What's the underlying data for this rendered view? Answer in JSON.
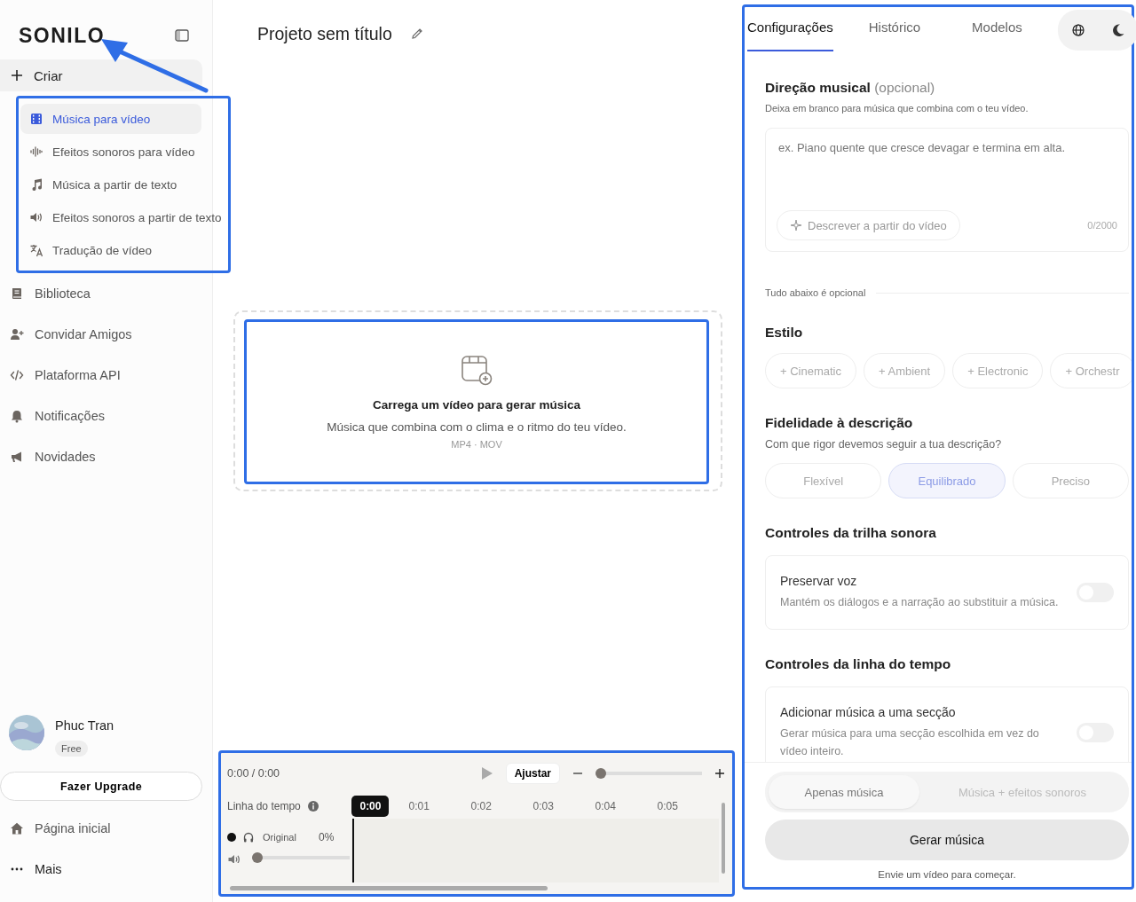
{
  "sidebar": {
    "logo": "SONILO",
    "create": {
      "label": "Criar",
      "items": [
        {
          "label": "Música para vídeo",
          "selected": true
        },
        {
          "label": "Efeitos sonoros para vídeo",
          "selected": false
        },
        {
          "label": "Música a partir de texto",
          "selected": false
        },
        {
          "label": "Efeitos sonoros a partir de texto",
          "selected": false
        },
        {
          "label": "Tradução de vídeo",
          "selected": false
        }
      ]
    },
    "nav": [
      "Biblioteca",
      "Convidar Amigos",
      "Plataforma API",
      "Notificações",
      "Novidades"
    ],
    "user": {
      "name": "Phuc Tran",
      "plan": "Free"
    },
    "upgrade_button": "Fazer Upgrade",
    "footer_nav": [
      "Página inicial",
      "Mais"
    ]
  },
  "project": {
    "title": "Projeto sem título"
  },
  "upload": {
    "title": "Carrega um vídeo para gerar música",
    "subtitle": "Música que combina com o clima e o ritmo do teu vídeo.",
    "formats": "MP4 · MOV"
  },
  "player": {
    "time": "0:00 / 0:00",
    "fit_button": "Ajustar",
    "zoom": {
      "level": 0
    },
    "timeline_label": "Linha do tempo",
    "current": "0:00",
    "ticks": [
      "0:01",
      "0:02",
      "0:03",
      "0:04",
      "0:05"
    ],
    "tracks": [
      {
        "name": "Original",
        "percent": "0%",
        "volume": {
          "level": 0
        }
      }
    ]
  },
  "settings": {
    "tabs": [
      {
        "label": "Configurações",
        "selected": true
      },
      {
        "label": "Histórico",
        "selected": false
      },
      {
        "label": "Modelos",
        "selected": false
      }
    ],
    "direction": {
      "title": "Direção musical",
      "optional": "(opcional)",
      "hint": "Deixa em branco para música que combina com o teu vídeo.",
      "placeholder": "ex. Piano quente que cresce devagar e termina em alta.",
      "describe_button": "Descrever a partir do vídeo",
      "counter": "0/2000"
    },
    "divider_label": "Tudo abaixo é opcional",
    "style": {
      "title": "Estilo",
      "chips": [
        "+ Cinematic",
        "+ Ambient",
        "+ Electronic",
        "+ Orchestr"
      ]
    },
    "fidelity": {
      "title": "Fidelidade à descrição",
      "hint": "Com que rigor devemos seguir a tua descrição?",
      "options": [
        {
          "label": "Flexível",
          "selected": false
        },
        {
          "label": "Equilibrado",
          "selected": true
        },
        {
          "label": "Preciso",
          "selected": false
        }
      ]
    },
    "sections": [
      {
        "title": "Controles da trilha sonora",
        "toggle": {
          "title": "Preservar voz",
          "description": "Mantém os diálogos e a narração ao substituir a música.",
          "on": false
        }
      },
      {
        "title": "Controles da linha do tempo",
        "toggle": {
          "title": "Adicionar música a uma secção",
          "description": "Gerar música para uma secção escolhida em vez do vídeo inteiro.",
          "on": false
        }
      }
    ],
    "mode": [
      {
        "label": "Apenas música",
        "selected": true
      },
      {
        "label": "Música + efeitos sonoros",
        "selected": false
      }
    ],
    "generate_button": "Gerar música",
    "footer_note": "Envie um vídeo para começar."
  },
  "highlights": {
    "create_menu": true,
    "upload": true,
    "player": true,
    "settings": true,
    "logo_arrow": true
  }
}
